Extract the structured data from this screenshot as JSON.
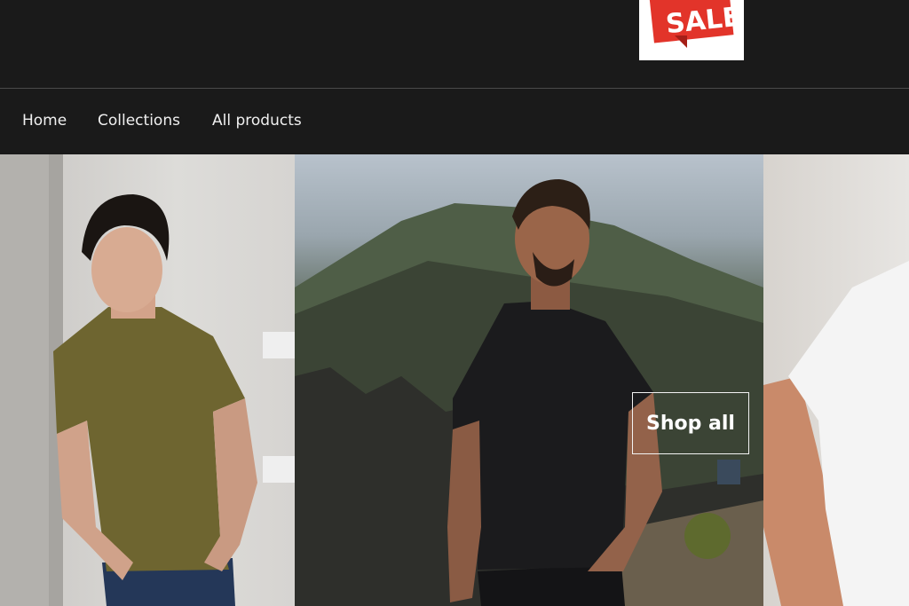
{
  "header": {
    "logo_text": "SALE",
    "logo_alt": "sale-ribbon-logo"
  },
  "nav": {
    "items": [
      {
        "label": "Home"
      },
      {
        "label": "Collections"
      },
      {
        "label": "All products"
      }
    ]
  },
  "hero": {
    "cta_label": "Shop all",
    "panels": [
      {
        "subject": "man in olive t-shirt leaning on wall",
        "shirt_color": "#6e6530"
      },
      {
        "subject": "man in black t-shirt in front of volcano",
        "shirt_color": "#1b1b1d"
      },
      {
        "subject": "man in white t-shirt",
        "shirt_color": "#f4f4f4"
      }
    ]
  },
  "colors": {
    "page_bg": "#1a1a1a",
    "logo_red": "#e2342a",
    "nav_text": "#f0f0f0"
  }
}
